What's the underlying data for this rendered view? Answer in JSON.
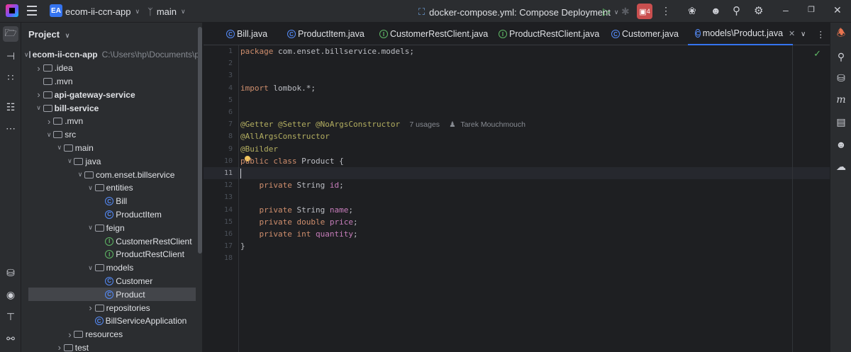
{
  "titlebar": {
    "project_badge": "EA",
    "project_name": "ecom-ii-ccn-app",
    "branch": "main",
    "run_config": "docker-compose.yml: Compose Deployment",
    "stop_badge": "4"
  },
  "project_panel": {
    "title": "Project",
    "nodes": [
      {
        "label": "ecom-ii-ccn-app",
        "path": "C:\\Users\\hp\\Documents\\p"
      },
      {
        "label": ".idea"
      },
      {
        "label": ".mvn"
      },
      {
        "label": "api-gateway-service"
      },
      {
        "label": "bill-service"
      },
      {
        "label": ".mvn"
      },
      {
        "label": "src"
      },
      {
        "label": "main"
      },
      {
        "label": "java"
      },
      {
        "label": "com.enset.billservice"
      },
      {
        "label": "entities"
      },
      {
        "label": "Bill"
      },
      {
        "label": "ProductItem"
      },
      {
        "label": "feign"
      },
      {
        "label": "CustomerRestClient"
      },
      {
        "label": "ProductRestClient"
      },
      {
        "label": "models"
      },
      {
        "label": "Customer"
      },
      {
        "label": "Product"
      },
      {
        "label": "repositories"
      },
      {
        "label": "BillServiceApplication"
      },
      {
        "label": "resources"
      },
      {
        "label": "test"
      }
    ]
  },
  "tabs": [
    {
      "label": "Bill.java"
    },
    {
      "label": "ProductItem.java"
    },
    {
      "label": "CustomerRestClient.java"
    },
    {
      "label": "ProductRestClient.java"
    },
    {
      "label": "Customer.java"
    },
    {
      "label": "models\\Product.java"
    }
  ],
  "editor": {
    "line_numbers": [
      "1",
      "2",
      "3",
      "4",
      "5",
      "6",
      "7",
      "8",
      "9",
      "10",
      "11",
      "12",
      "13",
      "14",
      "15",
      "16",
      "17",
      "18"
    ],
    "current_line": "11",
    "usage_hint": "7 usages",
    "author_hint": "Tarek Mouchmouch",
    "code": {
      "l1_kw": "package",
      "l1_rest": " com.enset.billservice.models;",
      "l4_kw": "import",
      "l4_rest": " lombok.*;",
      "l7_ann": "@Getter @Setter @NoArgsConstructor",
      "l8_ann": "@AllArgsConstructor",
      "l9_ann": "@Builder",
      "l10_kw1": "public",
      "l10_kw2": "class",
      "l10_rest": " Product {",
      "l12_kw": "private",
      "l12_type": " String ",
      "l12_fld": "id",
      "l14_kw": "private",
      "l14_type": " String ",
      "l14_fld": "name",
      "l15_kw1": "private",
      "l15_kw2": "double",
      "l15_fld": "price",
      "l16_kw1": "private",
      "l16_kw2": "int",
      "l16_fld": "quantity",
      "semicolon": ";",
      "l17": "}"
    }
  }
}
